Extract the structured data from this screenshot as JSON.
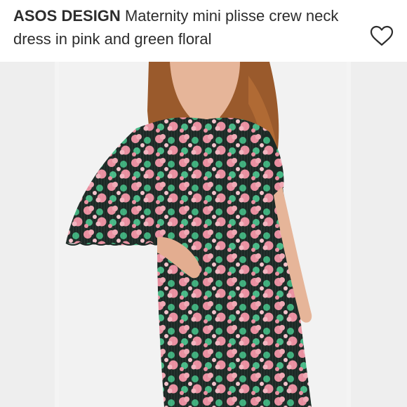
{
  "product": {
    "brand": "ASOS DESIGN",
    "name": "Maternity mini plisse crew neck dress in pink and green floral"
  },
  "icons": {
    "favorite": "heart-outline-icon"
  },
  "colors": {
    "text": "#2d2d2d",
    "background": "#ffffff",
    "print_pink": "#e98fa0",
    "print_green": "#3fae7c",
    "print_dark": "#1d2a26"
  }
}
